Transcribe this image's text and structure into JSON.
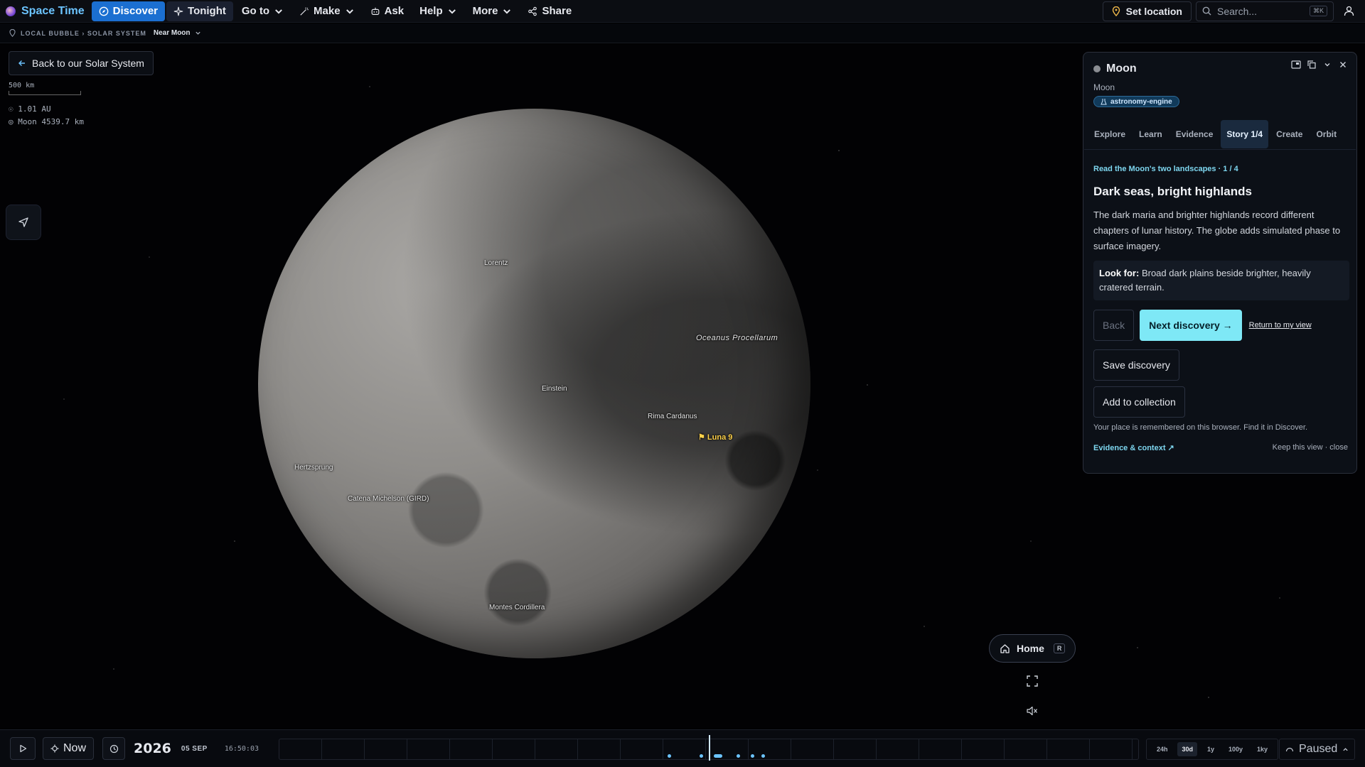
{
  "app": {
    "name": "Space Time"
  },
  "nav": {
    "discover": "Discover",
    "tonight": "Tonight",
    "goto": "Go to",
    "make": "Make",
    "ask": "Ask",
    "help": "Help",
    "more": "More",
    "share": "Share"
  },
  "topright": {
    "set_location": "Set location",
    "search_placeholder": "Search...",
    "search_shortcut": "⌘K"
  },
  "breadcrumb": {
    "path": "LOCAL BUBBLE › SOLAR SYSTEM",
    "current": "Near Moon"
  },
  "back_button": "Back to our Solar System",
  "scale": {
    "label": "500 km"
  },
  "readout": {
    "distance": "1.01 AU",
    "target": "Moon 4539.7 km"
  },
  "moon_labels": {
    "lorentz": "Lorentz",
    "oceanus": "Oceanus Procellarum",
    "einstein": "Einstein",
    "rima": "Rima Cardanus",
    "luna9": "Luna 9",
    "hertzsprung": "Hertzsprung",
    "catena": "Catena Michelson (GIRD)",
    "montes": "Montes Cordillera"
  },
  "panel": {
    "title": "Moon",
    "subtitle": "Moon",
    "chip": "astronomy-engine",
    "tabs": [
      "Explore",
      "Learn",
      "Evidence",
      "Story 1/4",
      "Create",
      "Orbit"
    ],
    "story_meta": "Read the Moon's two landscapes · 1 / 4",
    "story_title": "Dark seas, bright highlands",
    "story_body": "The dark maria and brighter highlands record different chapters of lunar history. The globe adds simulated phase to surface imagery.",
    "lookfor_label": "Look for:",
    "lookfor_text": " Broad dark plains beside brighter, heavily cratered terrain.",
    "back": "Back",
    "next": "Next discovery →",
    "return": "Return to my view",
    "save": "Save discovery",
    "add": "Add to collection",
    "note": "Your place is remembered on this browser. Find it in Discover.",
    "evidence": "Evidence & context ↗",
    "keep": "Keep this view · close"
  },
  "home": {
    "label": "Home",
    "key": "R"
  },
  "timeline": {
    "now": "Now",
    "year": "2026",
    "date": "05 SEP",
    "time": "16:50:03",
    "ranges": [
      "24h",
      "30d",
      "1y",
      "100y",
      "1ky"
    ],
    "active_range": "30d",
    "state": "Paused"
  },
  "colors": {
    "accent": "#1b6fd1",
    "primary_button": "#7ee8f6",
    "link": "#7ed7f0",
    "luna_marker": "#ffd24a"
  }
}
